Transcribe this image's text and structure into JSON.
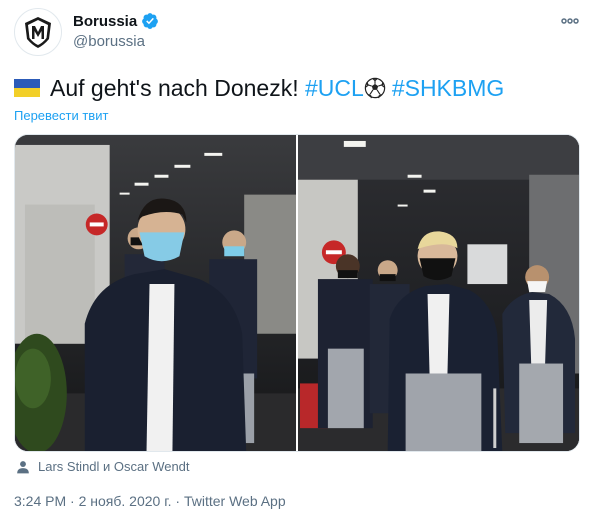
{
  "header": {
    "display_name": "Borussia",
    "handle": "@borussia",
    "verified": true,
    "avatar_icon": "borussia-crest-icon",
    "more_icon": "more-options-icon"
  },
  "tweet": {
    "text_main": "Auf geht's nach Donezk! ",
    "hashtag1": "#UCL",
    "hashtag2": "#SHKBMG",
    "flag_icon": "ukraine-flag-icon",
    "ball_icon": "soccer-ball-icon",
    "translate_label": "Перевести твит"
  },
  "media": {
    "photo_count": 2
  },
  "tagged": {
    "icon": "person-icon",
    "text": "Lars Stindl и Oscar Wendt"
  },
  "meta": {
    "time": "3:24 PM",
    "sep1": " · ",
    "date": "2 нояб. 2020 г.",
    "sep2": " · ",
    "source": "Twitter Web App"
  },
  "colors": {
    "accent": "#1da1f2",
    "text": "#0f1419",
    "secondary": "#5b7083"
  }
}
